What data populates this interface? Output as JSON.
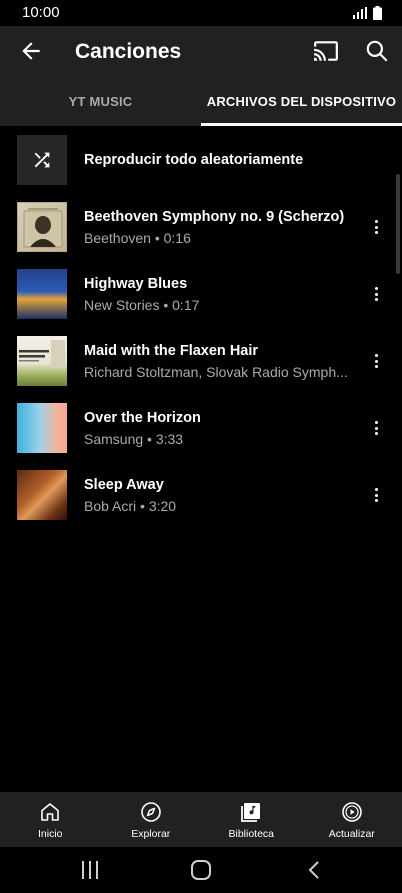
{
  "status": {
    "time": "10:00"
  },
  "header": {
    "title": "Canciones"
  },
  "tabs": [
    {
      "label": "YT MUSIC",
      "active": false
    },
    {
      "label": "ARCHIVOS DEL DISPOSITIVO",
      "active": true
    }
  ],
  "shuffle": {
    "label": "Reproducir todo aleatoriamente"
  },
  "songs": [
    {
      "title": "Beethoven Symphony no. 9 (Scherzo)",
      "subtitle": "Beethoven • 0:16"
    },
    {
      "title": "Highway Blues",
      "subtitle": "New Stories • 0:17"
    },
    {
      "title": "Maid with the Flaxen Hair",
      "subtitle": "Richard Stoltzman, Slovak Radio Symph..."
    },
    {
      "title": "Over the Horizon",
      "subtitle": "Samsung • 3:33"
    },
    {
      "title": "Sleep Away",
      "subtitle": "Bob Acri • 3:20"
    }
  ],
  "bottom_nav": [
    {
      "label": "Inicio",
      "icon": "home-icon"
    },
    {
      "label": "Explorar",
      "icon": "compass-icon"
    },
    {
      "label": "Biblioteca",
      "icon": "library-icon",
      "active": true
    },
    {
      "label": "Actualizar",
      "icon": "upgrade-icon"
    }
  ],
  "colors": {
    "background": "#000000",
    "header": "#212121",
    "secondary_text": "#aaaaaa",
    "accent": "#ffffff"
  }
}
